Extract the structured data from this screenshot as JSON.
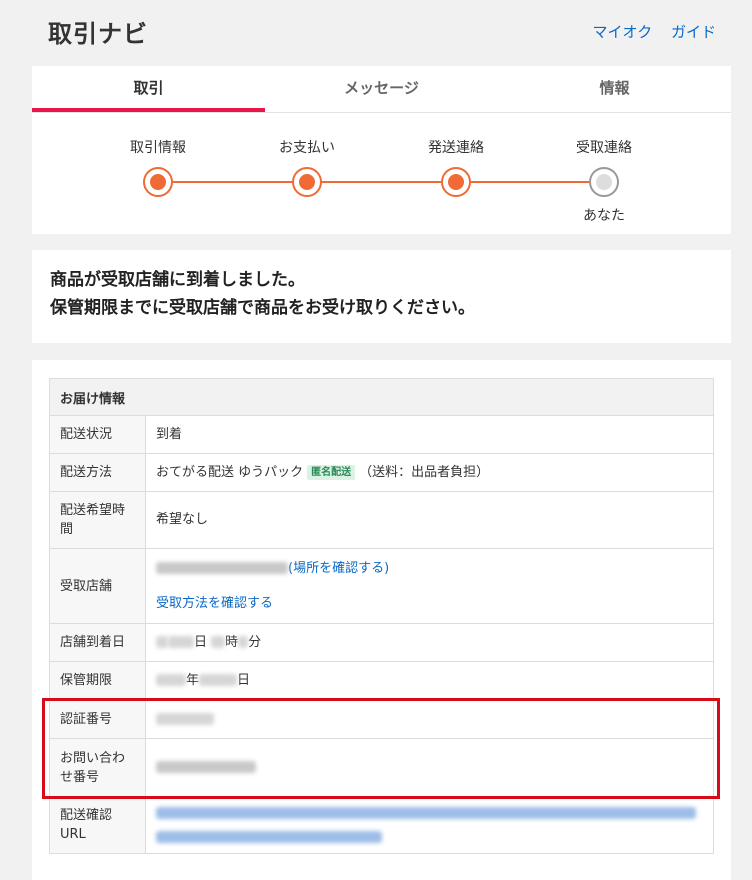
{
  "header": {
    "title": "取引ナビ",
    "links": [
      "マイオク",
      "ガイド"
    ]
  },
  "tabs": [
    {
      "label": "取引",
      "active": true
    },
    {
      "label": "メッセージ",
      "active": false
    },
    {
      "label": "情報",
      "active": false
    }
  ],
  "steps": [
    {
      "label": "取引情報",
      "done": true,
      "sub": ""
    },
    {
      "label": "お支払い",
      "done": true,
      "sub": ""
    },
    {
      "label": "発送連絡",
      "done": true,
      "sub": ""
    },
    {
      "label": "受取連絡",
      "done": false,
      "sub": "あなた"
    }
  ],
  "message": {
    "line1": "商品が受取店舗に到着しました。",
    "line2": "保管期限までに受取店舗で商品をお受け取りください。"
  },
  "delivery": {
    "section_title": "お届け情報",
    "rows": {
      "status": {
        "label": "配送状況",
        "value": "到着"
      },
      "method": {
        "label": "配送方法",
        "value": "おてがる配送 ゆうパック",
        "badge": "匿名配送",
        "note": "（送料：出品者負担）"
      },
      "time": {
        "label": "配送希望時間",
        "value": "希望なし"
      },
      "store": {
        "label": "受取店舗",
        "location_link": "(場所を確認する)",
        "method_link": "受取方法を確認する"
      },
      "arrival": {
        "label": "店舗到着日",
        "unit_day": "日",
        "unit_hour": "時",
        "unit_min": "分"
      },
      "deadline": {
        "label": "保管期限",
        "unit_year": "年",
        "unit_day": "日"
      },
      "auth": {
        "label": "認証番号"
      },
      "inquiry": {
        "label": "お問い合わせ番号"
      },
      "url": {
        "label": "配送確認URL"
      }
    }
  },
  "colors": {
    "accent": "#e8164b",
    "progress": "#f06a35",
    "link": "#0a69c7",
    "highlight": "#d80c18"
  }
}
